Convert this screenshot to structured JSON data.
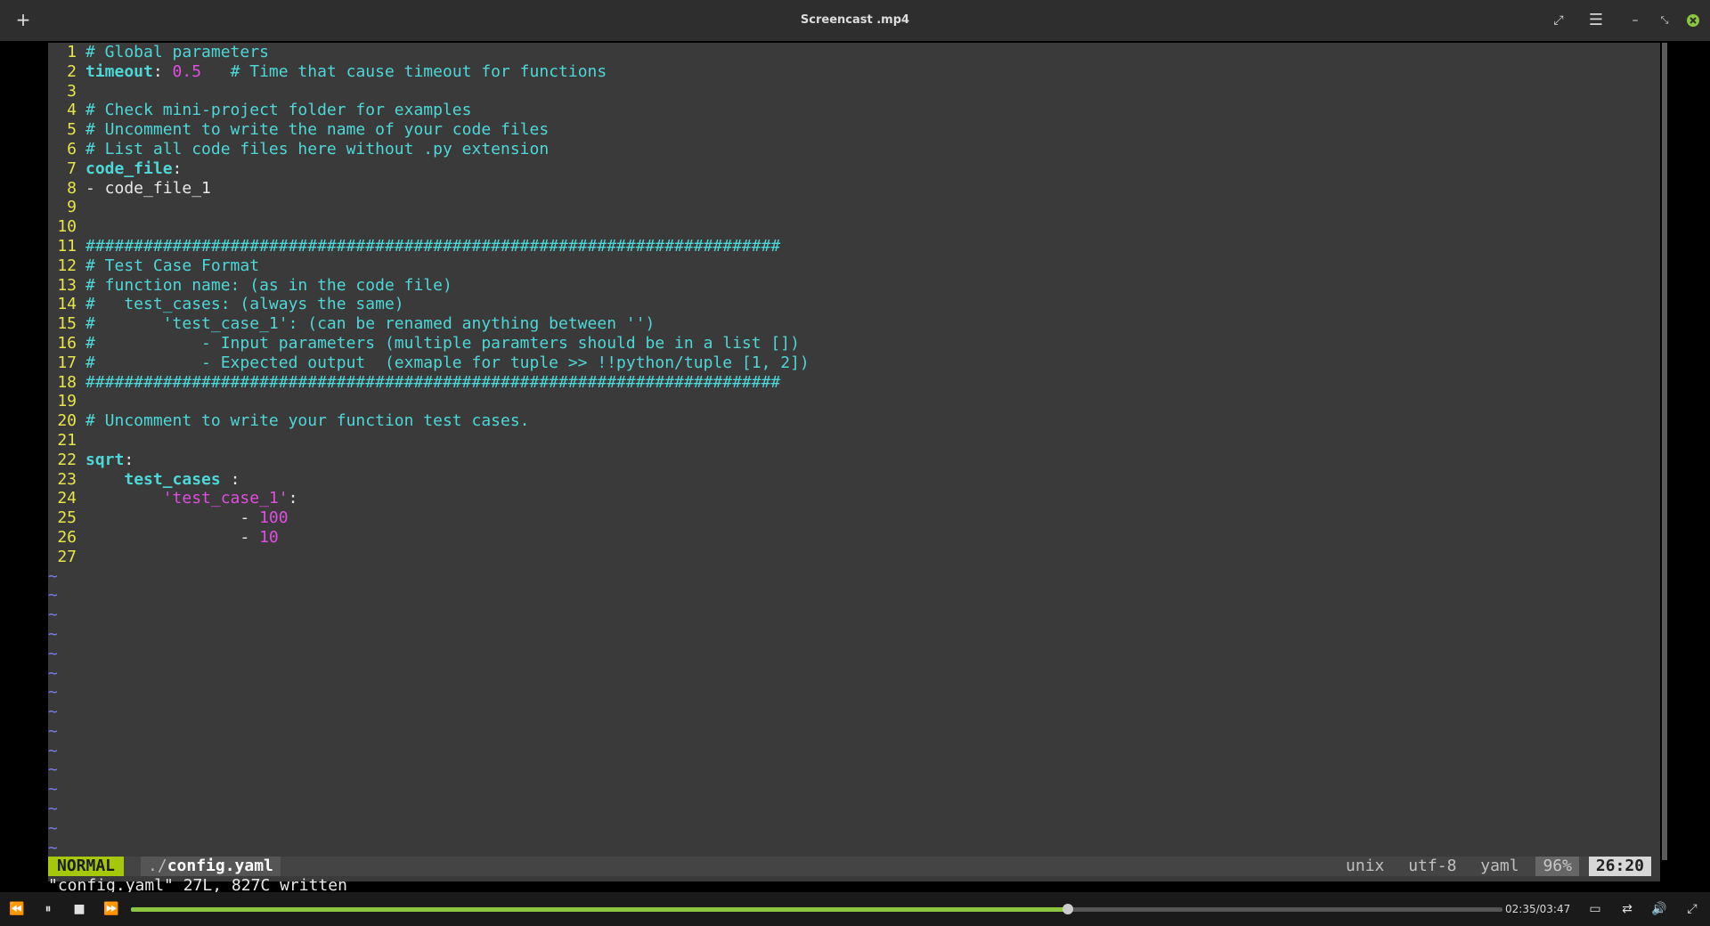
{
  "window": {
    "title": "Screencast .mp4"
  },
  "editor": {
    "lines": [
      {
        "n": "1",
        "parts": [
          {
            "t": "# Global parameters",
            "c": "c-comment"
          }
        ]
      },
      {
        "n": "2",
        "parts": [
          {
            "t": "timeout",
            "c": "c-key"
          },
          {
            "t": ": ",
            "c": "c-plain"
          },
          {
            "t": "0.5",
            "c": "c-num"
          },
          {
            "t": "   # Time that cause timeout for functions",
            "c": "c-comment"
          }
        ]
      },
      {
        "n": "3",
        "parts": []
      },
      {
        "n": "4",
        "parts": [
          {
            "t": "# Check mini-project folder for examples",
            "c": "c-comment"
          }
        ]
      },
      {
        "n": "5",
        "parts": [
          {
            "t": "# Uncomment to write the name of your code files",
            "c": "c-comment"
          }
        ]
      },
      {
        "n": "6",
        "parts": [
          {
            "t": "# List all code files here without .py extension",
            "c": "c-comment"
          }
        ]
      },
      {
        "n": "7",
        "parts": [
          {
            "t": "code_file",
            "c": "c-key"
          },
          {
            "t": ":",
            "c": "c-plain"
          }
        ]
      },
      {
        "n": "8",
        "parts": [
          {
            "t": "- code_file_1",
            "c": "c-plain"
          }
        ]
      },
      {
        "n": "9",
        "parts": []
      },
      {
        "n": "10",
        "parts": []
      },
      {
        "n": "11",
        "parts": [
          {
            "t": "########################################################################",
            "c": "c-comment"
          }
        ]
      },
      {
        "n": "12",
        "parts": [
          {
            "t": "# Test Case Format",
            "c": "c-comment"
          }
        ]
      },
      {
        "n": "13",
        "parts": [
          {
            "t": "# function name: (as in the code file)",
            "c": "c-comment"
          }
        ]
      },
      {
        "n": "14",
        "parts": [
          {
            "t": "#   test_cases: (always the same)",
            "c": "c-comment"
          }
        ]
      },
      {
        "n": "15",
        "parts": [
          {
            "t": "#       'test_case_1': (can be renamed anything between '')",
            "c": "c-comment"
          }
        ]
      },
      {
        "n": "16",
        "parts": [
          {
            "t": "#           - Input parameters (multiple paramters should be in a list [])",
            "c": "c-comment"
          }
        ]
      },
      {
        "n": "17",
        "parts": [
          {
            "t": "#           - Expected output  (exmaple for tuple >> !!python/tuple [1, 2])",
            "c": "c-comment"
          }
        ]
      },
      {
        "n": "18",
        "parts": [
          {
            "t": "########################################################################",
            "c": "c-comment"
          }
        ]
      },
      {
        "n": "19",
        "parts": []
      },
      {
        "n": "20",
        "parts": [
          {
            "t": "# Uncomment to write your function test cases.",
            "c": "c-comment"
          }
        ]
      },
      {
        "n": "21",
        "parts": []
      },
      {
        "n": "22",
        "parts": [
          {
            "t": "sqrt",
            "c": "c-key"
          },
          {
            "t": ":",
            "c": "c-plain"
          }
        ]
      },
      {
        "n": "23",
        "parts": [
          {
            "t": "    ",
            "c": "c-plain"
          },
          {
            "t": "test_cases",
            "c": "c-key"
          },
          {
            "t": " :",
            "c": "c-plain"
          }
        ]
      },
      {
        "n": "24",
        "parts": [
          {
            "t": "        ",
            "c": "c-plain"
          },
          {
            "t": "'test_case_1'",
            "c": "c-str"
          },
          {
            "t": ":",
            "c": "c-plain"
          }
        ]
      },
      {
        "n": "25",
        "parts": [
          {
            "t": "                - ",
            "c": "c-plain"
          },
          {
            "t": "100",
            "c": "c-num"
          }
        ]
      },
      {
        "n": "26",
        "parts": [
          {
            "t": "                - ",
            "c": "c-plain"
          },
          {
            "t": "10",
            "c": "c-num"
          }
        ]
      },
      {
        "n": "27",
        "parts": []
      }
    ],
    "tilde_count": 15
  },
  "statusline": {
    "mode": "NORMAL",
    "file_prefix": "./",
    "file_name": "config.yaml",
    "fileformat": "unix",
    "encoding": "utf-8",
    "filetype": "yaml",
    "percent": "96%",
    "position": "26:20"
  },
  "cmdline": "\"config.yaml\" 27L, 827C written",
  "player": {
    "time": "02:35/03:47",
    "progress": 0.683
  }
}
